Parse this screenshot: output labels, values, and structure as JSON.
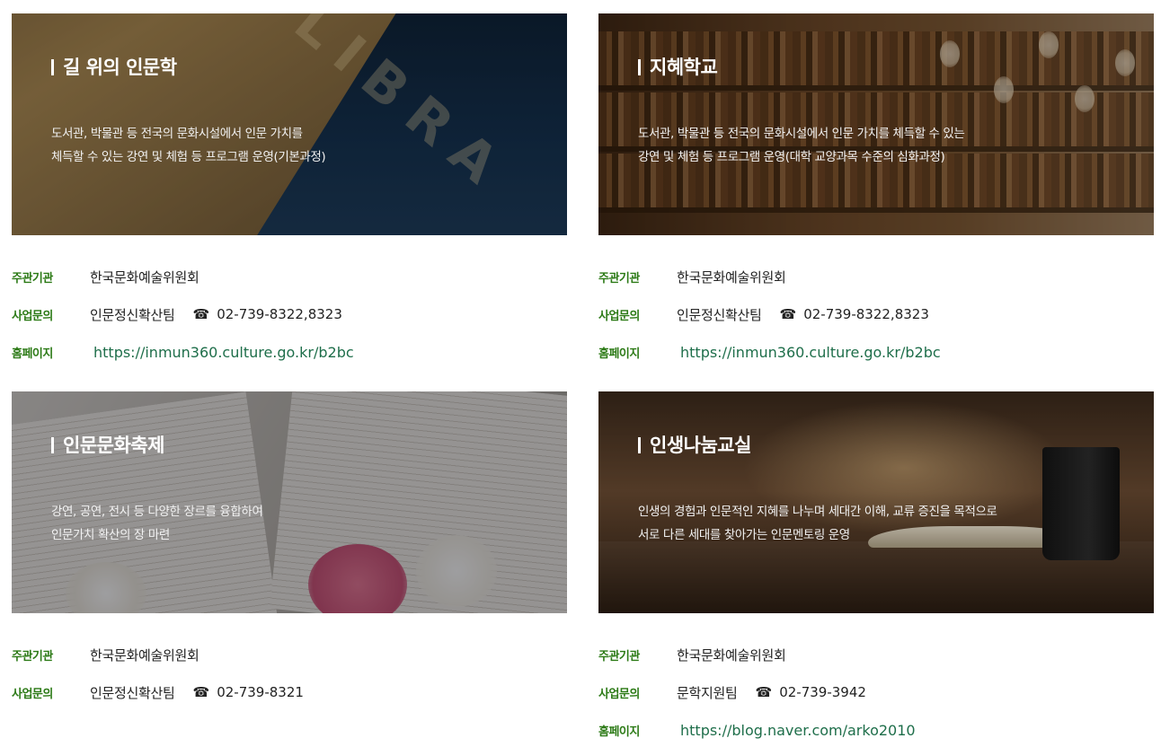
{
  "programs": [
    {
      "title": "길 위의 인문학",
      "desc_line1": "도서관, 박물관 등 전국의 문화시설에서 인문 가치를",
      "desc_line2": "체득할 수 있는 강연 및 체험 등 프로그램 운영(기본과정)",
      "organizer_label": "주관기관",
      "organizer": "한국문화예술위원회",
      "inquiry_label": "사업문의",
      "team": "인문정신확산팀",
      "phone_icon": "☎",
      "phone": "02-739-8322,8323",
      "homepage_label": "홈페이지",
      "homepage": "https://inmun360.culture.go.kr/b2bc"
    },
    {
      "title": "지혜학교",
      "desc_line1": "도서관, 박물관 등 전국의 문화시설에서 인문 가치를 체득할 수 있는",
      "desc_line2": "강연 및 체험 등 프로그램 운영(대학 교양과목 수준의 심화과정)",
      "organizer_label": "주관기관",
      "organizer": "한국문화예술위원회",
      "inquiry_label": "사업문의",
      "team": "인문정신확산팀",
      "phone_icon": "☎",
      "phone": "02-739-8322,8323",
      "homepage_label": "홈페이지",
      "homepage": "https://inmun360.culture.go.kr/b2bc"
    },
    {
      "title": "인문문화축제",
      "desc_line1": "강연, 공연, 전시 등 다양한 장르를 융합하여",
      "desc_line2": "인문가치 확산의 장 마련",
      "organizer_label": "주관기관",
      "organizer": "한국문화예술위원회",
      "inquiry_label": "사업문의",
      "team": "인문정신확산팀",
      "phone_icon": "☎",
      "phone": "02-739-8321"
    },
    {
      "title": "인생나눔교실",
      "desc_line1": "인생의 경험과 인문적인 지혜를 나누며 세대간 이해, 교류 증진을 목적으로",
      "desc_line2": "서로 다른 세대를 찾아가는 인문멘토링 운영",
      "organizer_label": "주관기관",
      "organizer": "한국문화예술위원회",
      "inquiry_label": "사업문의",
      "team": "문학지원팀",
      "phone_icon": "☎",
      "phone": "02-739-3942",
      "homepage_label": "홈페이지",
      "homepage": "https://blog.naver.com/arko2010"
    }
  ],
  "colors": {
    "label_green": "#2c7a16",
    "link_green": "#1e6e4a",
    "text": "#222222"
  }
}
